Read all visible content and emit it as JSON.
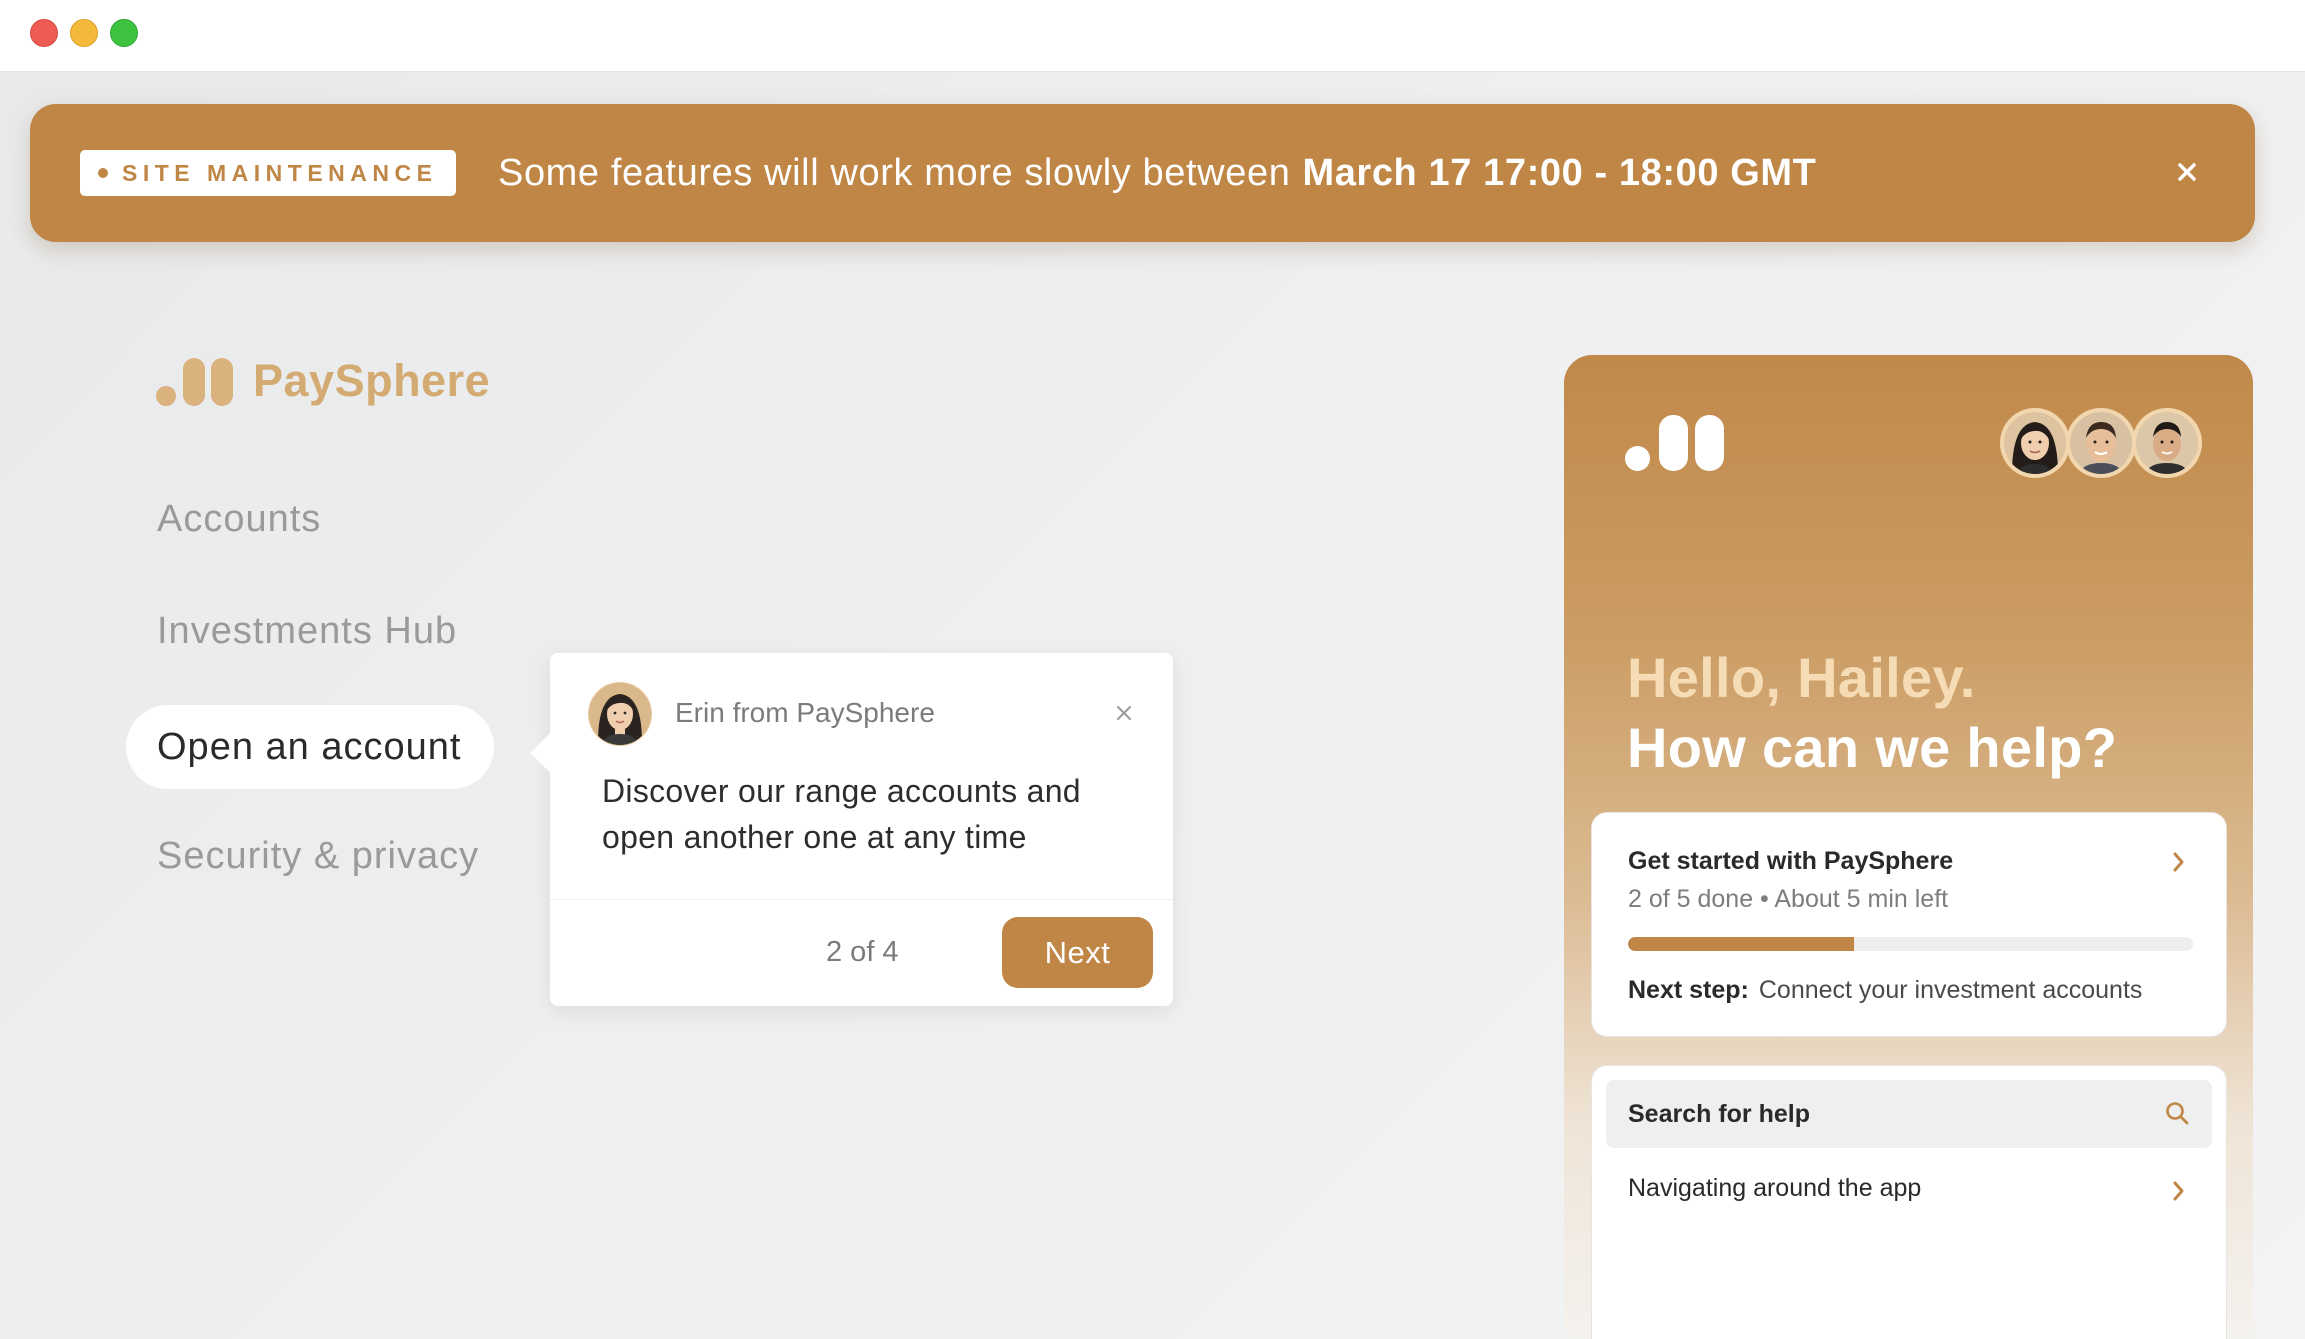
{
  "window": {
    "controls": [
      "close",
      "minimize",
      "maximize"
    ]
  },
  "banner": {
    "badge": "SITE MAINTENANCE",
    "message": "Some features will work more slowly between",
    "message_bold": "March 17 17:00 - 18:00 GMT",
    "close_icon": "close-icon",
    "color": "#bf8646"
  },
  "brand": {
    "name": "PaySphere",
    "color": "#d3aa72"
  },
  "nav": {
    "items": [
      {
        "label": "Accounts"
      },
      {
        "label": "Investments Hub"
      },
      {
        "label": "Open an account"
      },
      {
        "label": "Security & privacy"
      }
    ],
    "active_index": 2
  },
  "tooltip": {
    "from": "Erin from PaySphere",
    "body": "Discover our range accounts and open another one at any time",
    "step": "2 of 4",
    "next_label": "Next",
    "close_icon": "close-icon"
  },
  "help_panel": {
    "greeting": "Hello, Hailey.",
    "question": "How can we help?",
    "team_avatars": 3,
    "get_started": {
      "title": "Get started with PaySphere",
      "progress_text": "2 of 5 done • About 5 min left",
      "progress_fraction": 0.4,
      "next_step_label": "Next step:",
      "next_step_value": "Connect your investment accounts"
    },
    "search": {
      "label": "Search for help",
      "icon": "search-icon"
    },
    "articles": [
      {
        "label": "Navigating around the app"
      }
    ]
  }
}
